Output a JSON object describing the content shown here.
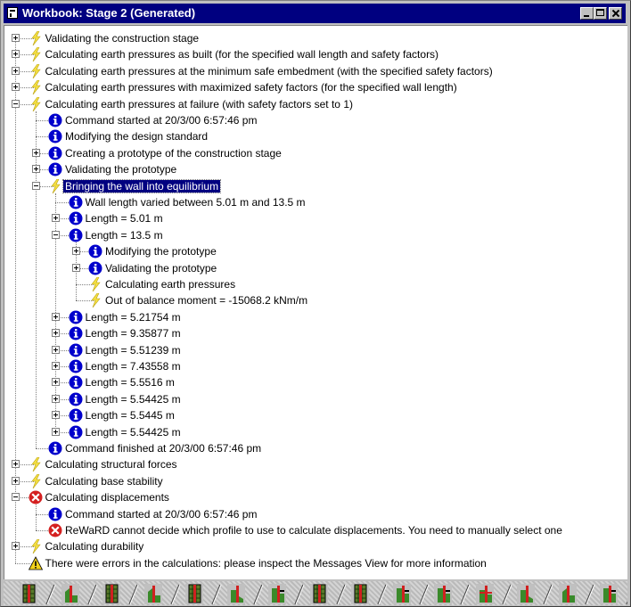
{
  "window": {
    "title": "Workbook: Stage 2 (Generated)",
    "buttons": [
      "minimize",
      "maximize",
      "close"
    ]
  },
  "icons": {
    "run": "lightning-icon",
    "info": "info-icon",
    "error": "error-icon",
    "warning": "warning-icon"
  },
  "tree": [
    {
      "depth": 0,
      "expander": "plus",
      "icon": "run",
      "text": "Validating the construction stage"
    },
    {
      "depth": 0,
      "expander": "plus",
      "icon": "run",
      "text": "Calculating earth pressures as built (for the specified wall length and safety factors)"
    },
    {
      "depth": 0,
      "expander": "plus",
      "icon": "run",
      "text": "Calculating earth pressures at the minimum safe embedment (with the specified safety factors)"
    },
    {
      "depth": 0,
      "expander": "plus",
      "icon": "run",
      "text": "Calculating earth pressures with maximized safety factors (for the specified wall length)"
    },
    {
      "depth": 0,
      "expander": "minus",
      "icon": "run",
      "text": "Calculating earth pressures at failure (with safety factors set to 1)"
    },
    {
      "depth": 1,
      "expander": "none",
      "icon": "info",
      "text": "Command started at 20/3/00 6:57:46 pm"
    },
    {
      "depth": 1,
      "expander": "none",
      "icon": "info",
      "text": "Modifying the design standard"
    },
    {
      "depth": 1,
      "expander": "plus",
      "icon": "info",
      "text": "Creating a prototype of the construction stage"
    },
    {
      "depth": 1,
      "expander": "plus",
      "icon": "info",
      "text": "Validating the prototype"
    },
    {
      "depth": 1,
      "expander": "minus",
      "icon": "run",
      "text": "Bringing the wall into equilibrium",
      "selected": true
    },
    {
      "depth": 2,
      "expander": "none",
      "icon": "info",
      "text": "Wall length varied between 5.01 m and 13.5 m"
    },
    {
      "depth": 2,
      "expander": "plus",
      "icon": "info",
      "text": "Length = 5.01 m"
    },
    {
      "depth": 2,
      "expander": "minus",
      "icon": "info",
      "text": "Length = 13.5 m"
    },
    {
      "depth": 3,
      "expander": "plus",
      "icon": "info",
      "text": "Modifying the prototype"
    },
    {
      "depth": 3,
      "expander": "plus",
      "icon": "info",
      "text": "Validating the prototype"
    },
    {
      "depth": 3,
      "expander": "none",
      "icon": "run",
      "text": "Calculating earth pressures"
    },
    {
      "depth": 3,
      "expander": "none",
      "icon": "run",
      "text": "Out of balance moment = -15068.2 kNm/m"
    },
    {
      "depth": 2,
      "expander": "plus",
      "icon": "info",
      "text": "Length = 5.21754 m"
    },
    {
      "depth": 2,
      "expander": "plus",
      "icon": "info",
      "text": "Length = 9.35877 m"
    },
    {
      "depth": 2,
      "expander": "plus",
      "icon": "info",
      "text": "Length = 5.51239 m"
    },
    {
      "depth": 2,
      "expander": "plus",
      "icon": "info",
      "text": "Length = 7.43558 m"
    },
    {
      "depth": 2,
      "expander": "plus",
      "icon": "info",
      "text": "Length = 5.5516 m"
    },
    {
      "depth": 2,
      "expander": "plus",
      "icon": "info",
      "text": "Length = 5.54425 m"
    },
    {
      "depth": 2,
      "expander": "plus",
      "icon": "info",
      "text": "Length = 5.5445 m"
    },
    {
      "depth": 2,
      "expander": "plus",
      "icon": "info",
      "text": "Length = 5.54425 m"
    },
    {
      "depth": 1,
      "expander": "none",
      "icon": "info",
      "text": "Command finished at 20/3/00 6:57:46 pm"
    },
    {
      "depth": 0,
      "expander": "plus",
      "icon": "run",
      "text": "Calculating structural forces"
    },
    {
      "depth": 0,
      "expander": "plus",
      "icon": "run",
      "text": "Calculating base stability"
    },
    {
      "depth": 0,
      "expander": "minus",
      "icon": "error",
      "text": "Calculating displacements"
    },
    {
      "depth": 1,
      "expander": "none",
      "icon": "info",
      "text": "Command started at 20/3/00 6:57:46 pm"
    },
    {
      "depth": 1,
      "expander": "none",
      "icon": "error",
      "text": "ReWaRD cannot decide which profile to use to calculate displacements. You need to manually select one"
    },
    {
      "depth": 0,
      "expander": "plus",
      "icon": "run",
      "text": "Calculating durability"
    },
    {
      "depth": 0,
      "expander": "none",
      "icon": "warning",
      "text": "There were errors in the calculations: please inspect the Messages View for more information"
    }
  ],
  "tabs": [
    {
      "icon": "stage-grid-icon"
    },
    {
      "icon": "stage-excavation-icon"
    },
    {
      "icon": "stage-grid-icon"
    },
    {
      "icon": "stage-excavation-icon"
    },
    {
      "icon": "stage-grid-icon"
    },
    {
      "icon": "stage-berm-icon"
    },
    {
      "icon": "stage-prop-icon"
    },
    {
      "icon": "stage-grid-icon"
    },
    {
      "icon": "stage-grid-icon"
    },
    {
      "icon": "stage-prop-icon"
    },
    {
      "icon": "stage-prop-icon"
    },
    {
      "icon": "stage-anchor-icon"
    },
    {
      "icon": "stage-berm-icon"
    },
    {
      "icon": "stage-excavation-icon"
    },
    {
      "icon": "stage-prop-icon"
    }
  ],
  "colors": {
    "titlebar": "#000080",
    "selection": "#000080",
    "info": "#0000cc",
    "run": "#f5e043",
    "error": "#d42020",
    "warning": "#f2d21b"
  }
}
